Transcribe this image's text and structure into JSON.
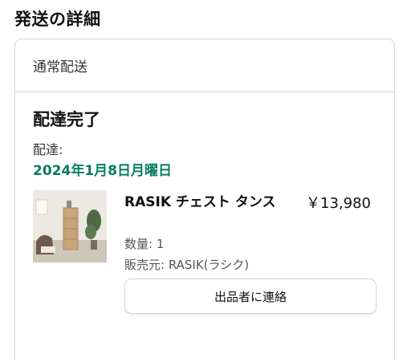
{
  "section": {
    "title": "発送の詳細"
  },
  "shipment": {
    "method": "通常配送",
    "status": "配達完了",
    "delivery_label": "配達:",
    "delivery_date": "2024年1月8日月曜日",
    "date_color": "#067d62"
  },
  "item": {
    "name": "RASIK チェスト タンス",
    "price": "￥13,980",
    "quantity": "数量: 1",
    "seller": "販売元: RASIK(ラシク)",
    "image_icon": "product-photo-chest-of-drawers"
  },
  "actions": {
    "contact_seller": "出品者に連絡"
  }
}
